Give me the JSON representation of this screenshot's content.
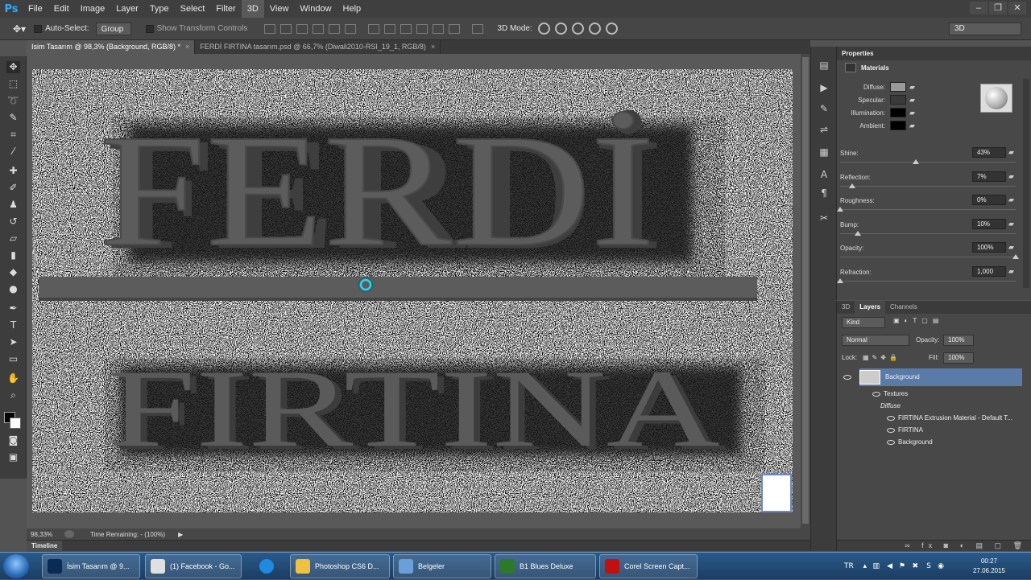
{
  "app": {
    "logo": "Ps"
  },
  "menu": [
    "File",
    "Edit",
    "Image",
    "Layer",
    "Type",
    "Select",
    "Filter",
    "3D",
    "View",
    "Window",
    "Help"
  ],
  "menu_active": "3D",
  "options": {
    "auto_select_label": "Auto-Select:",
    "auto_select_value": "Group",
    "transform_label": "Show Transform Controls",
    "mode_label": "3D Mode:",
    "workspace": "3D"
  },
  "tabs": [
    {
      "label": "Isim Tasarım @ 98,3% (Background, RGB/8) *",
      "active": true
    },
    {
      "label": "FERDİ FIRTINA tasarım.psd @ 66,7% (Diwali2010-RSI_19_1, RGB/8)",
      "active": false
    }
  ],
  "canvas": {
    "title_word": "FERDİ",
    "subtitle_word": "FIRTINA"
  },
  "status": {
    "zoom": "98,33%",
    "time_remaining": "Time Remaining: - (100%)",
    "timeline_tab": "Timeline"
  },
  "properties": {
    "panel_title": "Properties",
    "section": "Materials",
    "material_rows": [
      {
        "label": "Diffuse:",
        "color": "#9a9a9a"
      },
      {
        "label": "Specular:",
        "color": "#3a3a3a"
      },
      {
        "label": "Illumination:",
        "color": "#000000"
      },
      {
        "label": "Ambient:",
        "color": "#000000"
      }
    ],
    "sliders": [
      {
        "label": "Shine:",
        "value": "43%",
        "fraction": 0.43
      },
      {
        "label": "Reflection:",
        "value": "7%",
        "fraction": 0.07
      },
      {
        "label": "Roughness:",
        "value": "0%",
        "fraction": 0.0
      },
      {
        "label": "Bump:",
        "value": "10%",
        "fraction": 0.1
      },
      {
        "label": "Opacity:",
        "value": "100%",
        "fraction": 1.0
      },
      {
        "label": "Refraction:",
        "value": "1,000",
        "fraction": 0.0
      }
    ]
  },
  "layers": {
    "tabs": [
      "3D",
      "Layers",
      "Channels"
    ],
    "active_tab": "Layers",
    "kind": "Kind",
    "blend_mode": "Normal",
    "opacity_label": "Opacity:",
    "opacity": "100%",
    "lock_label": "Lock:",
    "fill_label": "Fill:",
    "fill": "100%",
    "items": [
      {
        "name": "Background",
        "indent": 0,
        "selected": true
      },
      {
        "name": "Textures",
        "indent": 1
      },
      {
        "name": "Diffuse",
        "indent": 2,
        "italic": true
      },
      {
        "name": "FIRTINA Extrusion Material - Default T...",
        "indent": 3
      },
      {
        "name": "FIRTINA",
        "indent": 3
      },
      {
        "name": "Background",
        "indent": 3
      }
    ]
  },
  "taskbar": {
    "tasks": [
      {
        "label": "İsim Tasarım @ 9...",
        "color": "#0b2a55"
      },
      {
        "label": "(1) Facebook - Go...",
        "color": "#e0e0e0"
      },
      {
        "label": "",
        "color": "#1e8ae0"
      },
      {
        "label": "Photoshop CS6 D...",
        "color": "#f0c040"
      },
      {
        "label": "Belgeler",
        "color": "#6aa0d8"
      },
      {
        "label": "B1 Blues Deluxe",
        "color": "#2a7a2a"
      },
      {
        "label": "Corel Screen Capt...",
        "color": "#c01010"
      }
    ],
    "language": "TR",
    "time": "00:27",
    "date": "27.06.2015"
  }
}
